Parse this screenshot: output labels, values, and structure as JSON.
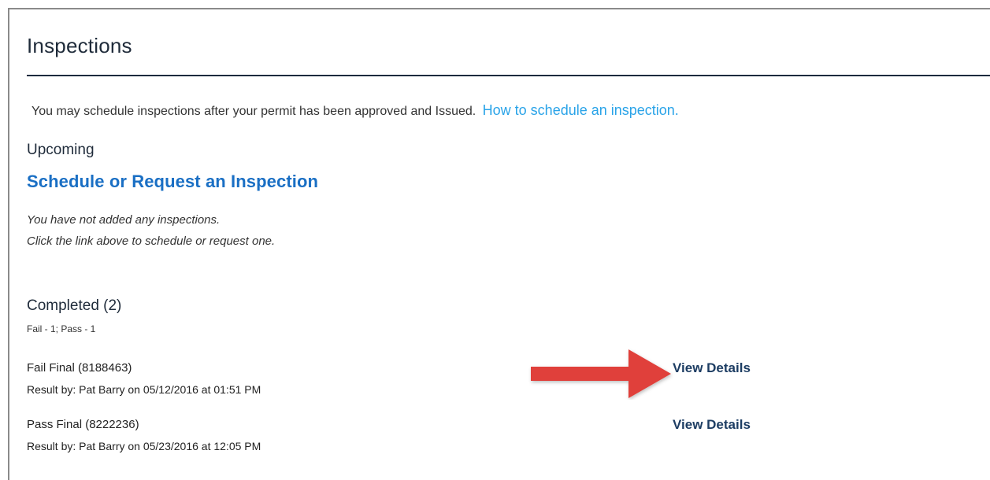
{
  "header": {
    "title": "Inspections"
  },
  "intro": {
    "text": "You may schedule inspections after your permit has been approved and Issued.",
    "link_label": "How to schedule an inspection."
  },
  "upcoming": {
    "label": "Upcoming",
    "schedule_link": "Schedule or Request an Inspection",
    "empty_line1": "You have not added any inspections.",
    "empty_line2": "Click the link above to schedule or request one."
  },
  "completed": {
    "label": "Completed (2)",
    "summary": "Fail - 1; Pass - 1",
    "items": [
      {
        "title": "Fail Final (8188463)",
        "result": "Result by: Pat Barry on 05/12/2016 at 01:51 PM",
        "action": "View Details"
      },
      {
        "title": "Pass Final (8222236)",
        "result": "Result by: Pat Barry on 05/23/2016 at 12:05 PM",
        "action": "View Details"
      }
    ]
  },
  "annotation": {
    "arrow_icon": "right-arrow-icon",
    "arrow_color": "#e0413b"
  },
  "colors": {
    "title": "#1f2b3a",
    "link": "#29a3e8",
    "schedule_link": "#1a6fc4",
    "view_details": "#1d3d63"
  }
}
